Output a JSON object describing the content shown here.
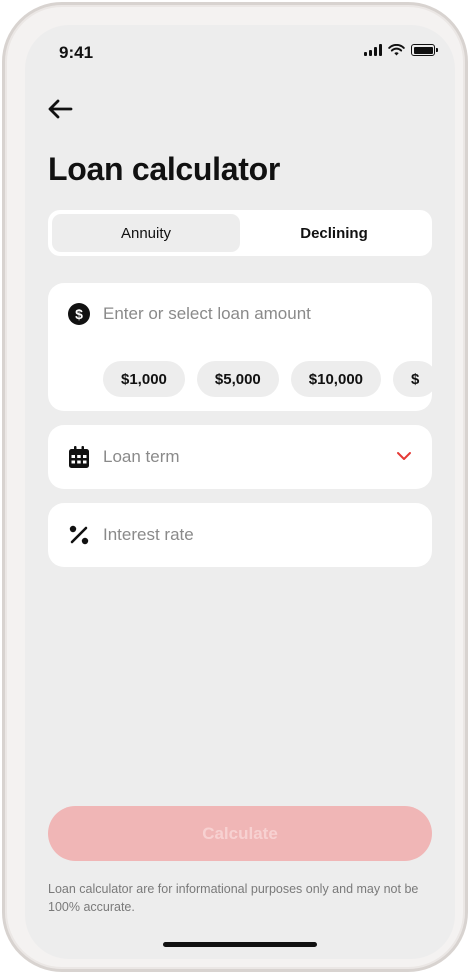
{
  "status_bar": {
    "time": "9:41"
  },
  "header": {
    "title": "Loan calculator"
  },
  "tabs": [
    {
      "label": "Annuity",
      "active": true
    },
    {
      "label": "Declining",
      "active": false
    }
  ],
  "amount": {
    "placeholder": "Enter or select loan amount",
    "chips": [
      "$1,000",
      "$5,000",
      "$10,000",
      "$"
    ]
  },
  "term": {
    "placeholder": "Loan term"
  },
  "rate": {
    "placeholder": "Interest rate"
  },
  "calculate": {
    "label": "Calculate",
    "enabled": false
  },
  "disclaimer": "Loan calculator are for informational purposes only and may not be 100% accurate.",
  "colors": {
    "accent": "#e53935",
    "button_disabled": "#f0b6b6",
    "background": "#ededed"
  },
  "icons": [
    "back-arrow-icon",
    "dollar-icon",
    "calendar-icon",
    "percent-icon",
    "chevron-down-icon"
  ]
}
